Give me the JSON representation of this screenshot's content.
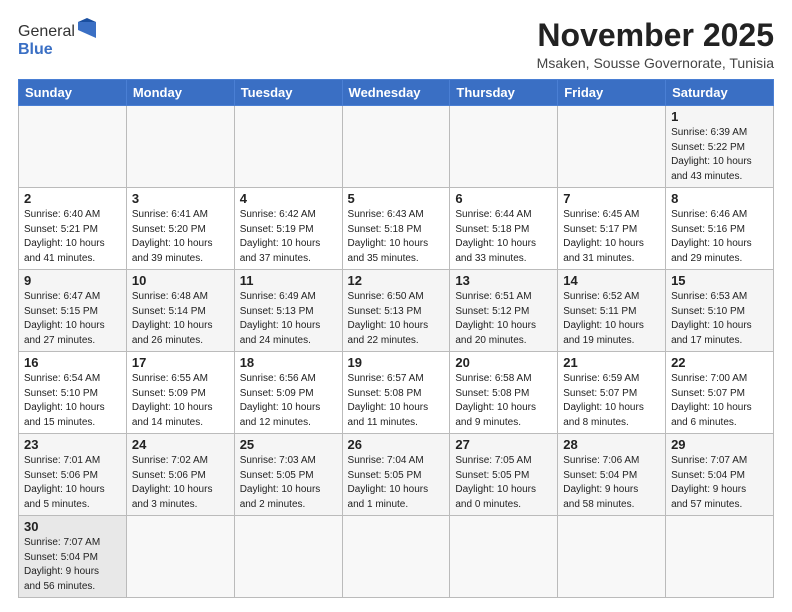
{
  "header": {
    "logo_general": "General",
    "logo_blue": "Blue",
    "month_title": "November 2025",
    "subtitle": "Msaken, Sousse Governorate, Tunisia"
  },
  "weekdays": [
    "Sunday",
    "Monday",
    "Tuesday",
    "Wednesday",
    "Thursday",
    "Friday",
    "Saturday"
  ],
  "weeks": [
    [
      {
        "day": "",
        "info": ""
      },
      {
        "day": "",
        "info": ""
      },
      {
        "day": "",
        "info": ""
      },
      {
        "day": "",
        "info": ""
      },
      {
        "day": "",
        "info": ""
      },
      {
        "day": "",
        "info": ""
      },
      {
        "day": "1",
        "info": "Sunrise: 6:39 AM\nSunset: 5:22 PM\nDaylight: 10 hours\nand 43 minutes."
      }
    ],
    [
      {
        "day": "2",
        "info": "Sunrise: 6:40 AM\nSunset: 5:21 PM\nDaylight: 10 hours\nand 41 minutes."
      },
      {
        "day": "3",
        "info": "Sunrise: 6:41 AM\nSunset: 5:20 PM\nDaylight: 10 hours\nand 39 minutes."
      },
      {
        "day": "4",
        "info": "Sunrise: 6:42 AM\nSunset: 5:19 PM\nDaylight: 10 hours\nand 37 minutes."
      },
      {
        "day": "5",
        "info": "Sunrise: 6:43 AM\nSunset: 5:18 PM\nDaylight: 10 hours\nand 35 minutes."
      },
      {
        "day": "6",
        "info": "Sunrise: 6:44 AM\nSunset: 5:18 PM\nDaylight: 10 hours\nand 33 minutes."
      },
      {
        "day": "7",
        "info": "Sunrise: 6:45 AM\nSunset: 5:17 PM\nDaylight: 10 hours\nand 31 minutes."
      },
      {
        "day": "8",
        "info": "Sunrise: 6:46 AM\nSunset: 5:16 PM\nDaylight: 10 hours\nand 29 minutes."
      }
    ],
    [
      {
        "day": "9",
        "info": "Sunrise: 6:47 AM\nSunset: 5:15 PM\nDaylight: 10 hours\nand 27 minutes."
      },
      {
        "day": "10",
        "info": "Sunrise: 6:48 AM\nSunset: 5:14 PM\nDaylight: 10 hours\nand 26 minutes."
      },
      {
        "day": "11",
        "info": "Sunrise: 6:49 AM\nSunset: 5:13 PM\nDaylight: 10 hours\nand 24 minutes."
      },
      {
        "day": "12",
        "info": "Sunrise: 6:50 AM\nSunset: 5:13 PM\nDaylight: 10 hours\nand 22 minutes."
      },
      {
        "day": "13",
        "info": "Sunrise: 6:51 AM\nSunset: 5:12 PM\nDaylight: 10 hours\nand 20 minutes."
      },
      {
        "day": "14",
        "info": "Sunrise: 6:52 AM\nSunset: 5:11 PM\nDaylight: 10 hours\nand 19 minutes."
      },
      {
        "day": "15",
        "info": "Sunrise: 6:53 AM\nSunset: 5:10 PM\nDaylight: 10 hours\nand 17 minutes."
      }
    ],
    [
      {
        "day": "16",
        "info": "Sunrise: 6:54 AM\nSunset: 5:10 PM\nDaylight: 10 hours\nand 15 minutes."
      },
      {
        "day": "17",
        "info": "Sunrise: 6:55 AM\nSunset: 5:09 PM\nDaylight: 10 hours\nand 14 minutes."
      },
      {
        "day": "18",
        "info": "Sunrise: 6:56 AM\nSunset: 5:09 PM\nDaylight: 10 hours\nand 12 minutes."
      },
      {
        "day": "19",
        "info": "Sunrise: 6:57 AM\nSunset: 5:08 PM\nDaylight: 10 hours\nand 11 minutes."
      },
      {
        "day": "20",
        "info": "Sunrise: 6:58 AM\nSunset: 5:08 PM\nDaylight: 10 hours\nand 9 minutes."
      },
      {
        "day": "21",
        "info": "Sunrise: 6:59 AM\nSunset: 5:07 PM\nDaylight: 10 hours\nand 8 minutes."
      },
      {
        "day": "22",
        "info": "Sunrise: 7:00 AM\nSunset: 5:07 PM\nDaylight: 10 hours\nand 6 minutes."
      }
    ],
    [
      {
        "day": "23",
        "info": "Sunrise: 7:01 AM\nSunset: 5:06 PM\nDaylight: 10 hours\nand 5 minutes."
      },
      {
        "day": "24",
        "info": "Sunrise: 7:02 AM\nSunset: 5:06 PM\nDaylight: 10 hours\nand 3 minutes."
      },
      {
        "day": "25",
        "info": "Sunrise: 7:03 AM\nSunset: 5:05 PM\nDaylight: 10 hours\nand 2 minutes."
      },
      {
        "day": "26",
        "info": "Sunrise: 7:04 AM\nSunset: 5:05 PM\nDaylight: 10 hours\nand 1 minute."
      },
      {
        "day": "27",
        "info": "Sunrise: 7:05 AM\nSunset: 5:05 PM\nDaylight: 10 hours\nand 0 minutes."
      },
      {
        "day": "28",
        "info": "Sunrise: 7:06 AM\nSunset: 5:04 PM\nDaylight: 9 hours\nand 58 minutes."
      },
      {
        "day": "29",
        "info": "Sunrise: 7:07 AM\nSunset: 5:04 PM\nDaylight: 9 hours\nand 57 minutes."
      }
    ],
    [
      {
        "day": "30",
        "info": "Sunrise: 7:07 AM\nSunset: 5:04 PM\nDaylight: 9 hours\nand 56 minutes."
      },
      {
        "day": "",
        "info": ""
      },
      {
        "day": "",
        "info": ""
      },
      {
        "day": "",
        "info": ""
      },
      {
        "day": "",
        "info": ""
      },
      {
        "day": "",
        "info": ""
      },
      {
        "day": "",
        "info": ""
      }
    ]
  ]
}
